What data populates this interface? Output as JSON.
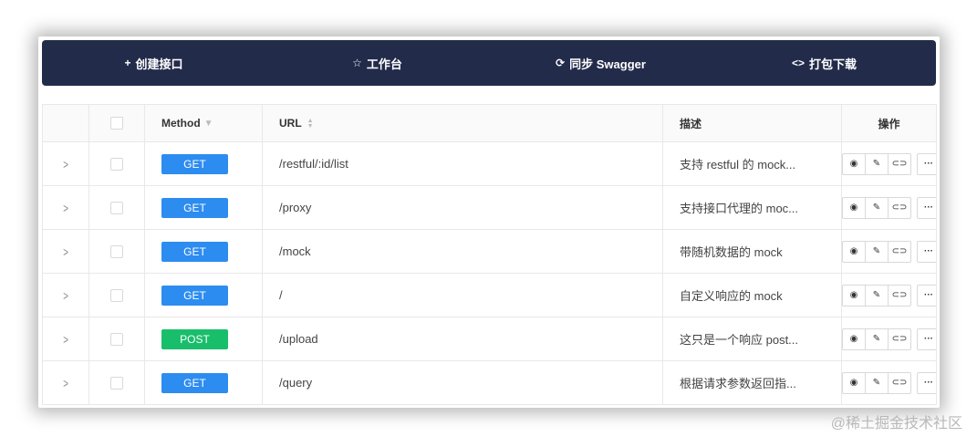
{
  "toolbar": {
    "items": [
      {
        "icon": "plus-icon",
        "glyph": "+",
        "label": "创建接口"
      },
      {
        "icon": "star-icon",
        "glyph": "☆",
        "label": "工作台"
      },
      {
        "icon": "sync-icon",
        "glyph": "⟳",
        "label": "同步 Swagger"
      },
      {
        "icon": "code-icon",
        "glyph": "<>",
        "label": "打包下载"
      }
    ]
  },
  "table": {
    "headers": {
      "method": "Method",
      "url": "URL",
      "description": "描述",
      "operations": "操作"
    },
    "rows": [
      {
        "method": "GET",
        "url": "/restful/:id/list",
        "description": "支持 restful 的 mock..."
      },
      {
        "method": "GET",
        "url": "/proxy",
        "description": "支持接口代理的 moc..."
      },
      {
        "method": "GET",
        "url": "/mock",
        "description": "带随机数据的 mock"
      },
      {
        "method": "GET",
        "url": "/",
        "description": "自定义响应的 mock"
      },
      {
        "method": "POST",
        "url": "/upload",
        "description": "这只是一个响应 post..."
      },
      {
        "method": "GET",
        "url": "/query",
        "description": "根据请求参数返回指..."
      }
    ]
  },
  "colors": {
    "toolbar_bg": "#232b4a",
    "get": "#2d8cf0",
    "post": "#19be6b"
  },
  "watermark": "@稀土掘金技术社区"
}
